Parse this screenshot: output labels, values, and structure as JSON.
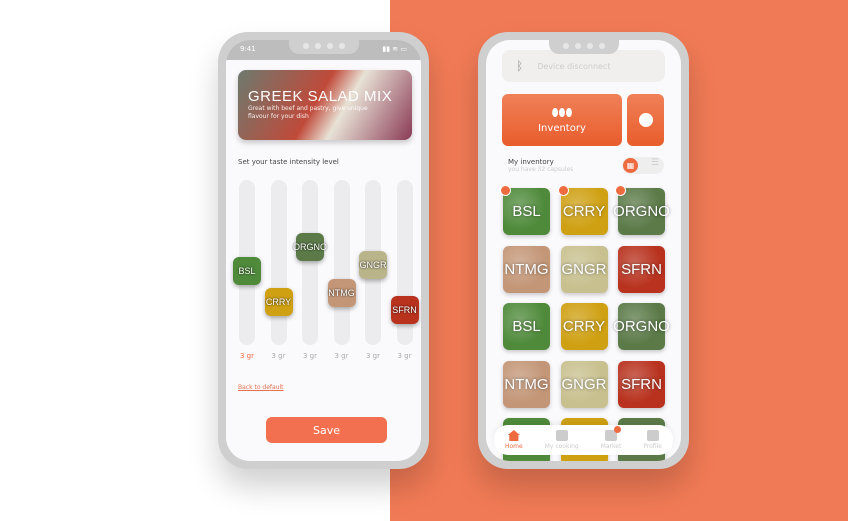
{
  "colors": {
    "accent": "#ee6a3f",
    "background_right": "#f07a55"
  },
  "left_phone": {
    "status_time": "9:41",
    "status_icons": "▮▮ ≋ ▭",
    "recipe": {
      "title": "GREEK SALAD MIX",
      "description": "Great with beef and pastry, give unique flavour for your dish"
    },
    "intensity_label": "Set your taste intensity level",
    "sliders": [
      {
        "name": "BSL",
        "level": 0.44,
        "amount": "3 gr",
        "active": true,
        "color": "#4e8a3a"
      },
      {
        "name": "CRRY",
        "level": 0.21,
        "amount": "3 gr",
        "active": false,
        "color": "#cfa012"
      },
      {
        "name": "ORGNO",
        "level": 0.61,
        "amount": "3 gr",
        "active": false,
        "color": "#5b7a48"
      },
      {
        "name": "NTMG",
        "level": 0.28,
        "amount": "3 gr",
        "active": false,
        "color": "#c39677"
      },
      {
        "name": "GNGR",
        "level": 0.48,
        "amount": "3 gr",
        "active": false,
        "color": "#b9b48a"
      },
      {
        "name": "SFRN",
        "level": 0.15,
        "amount": "3 gr",
        "active": false,
        "color": "#b8321e"
      }
    ],
    "back_link": "Back to default",
    "save_label": "Save"
  },
  "right_phone": {
    "device_status": "Device disconnect",
    "inventory_button": "Inventory",
    "my_inventory": {
      "title": "My inventory",
      "subtitle": "you have 32 capsules"
    },
    "view_toggle": {
      "selected": "grid"
    },
    "tiles": [
      {
        "name": "BSL",
        "color": "#4e8a3a",
        "pinned": true
      },
      {
        "name": "CRRY",
        "color": "#cfa012",
        "pinned": true
      },
      {
        "name": "ORGNO",
        "color": "#5b7a48",
        "pinned": true
      },
      {
        "name": "NTMG",
        "color": "#c39677",
        "pinned": false
      },
      {
        "name": "GNGR",
        "color": "#c8c08e",
        "pinned": false
      },
      {
        "name": "SFRN",
        "color": "#b8321e",
        "pinned": false
      },
      {
        "name": "BSL",
        "color": "#4e8a3a",
        "pinned": false
      },
      {
        "name": "CRRY",
        "color": "#cfa012",
        "pinned": false
      },
      {
        "name": "ORGNO",
        "color": "#5b7a48",
        "pinned": false
      },
      {
        "name": "NTMG",
        "color": "#c39677",
        "pinned": false
      },
      {
        "name": "GNGR",
        "color": "#c8c08e",
        "pinned": false
      },
      {
        "name": "SFRN",
        "color": "#b8321e",
        "pinned": false
      }
    ],
    "nav": [
      {
        "label": "Home",
        "icon": "home-icon",
        "active": true
      },
      {
        "label": "My cooking",
        "icon": "cooking-icon",
        "active": false
      },
      {
        "label": "Market",
        "icon": "market-icon",
        "active": false,
        "badge": true
      },
      {
        "label": "Profile",
        "icon": "profile-icon",
        "active": false
      }
    ]
  }
}
